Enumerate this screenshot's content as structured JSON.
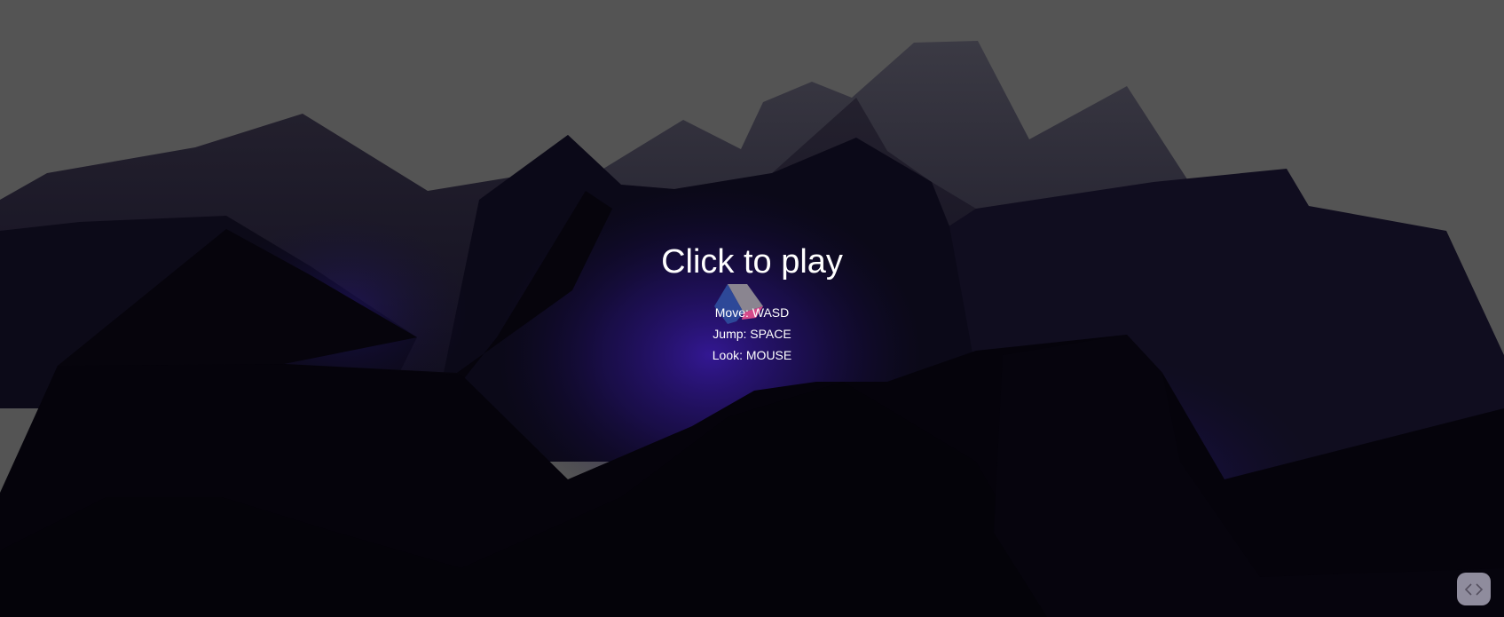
{
  "overlay": {
    "title": "Click to play",
    "controls": [
      {
        "action": "Move",
        "key": "WASD",
        "text": "Move: WASD"
      },
      {
        "action": "Jump",
        "key": "SPACE",
        "text": "Jump: SPACE"
      },
      {
        "action": "Look",
        "key": "MOUSE",
        "text": "Look: MOUSE"
      }
    ]
  },
  "scene": {
    "sky_color": "#545454",
    "terrain_dark": "#07050f",
    "terrain_mid": "#16122a",
    "glow_color": "#3a1aa8",
    "player_colors": [
      "#2f4f9e",
      "#8a8590",
      "#d54a8a"
    ]
  },
  "corner_button": {
    "icon": "code-icon"
  }
}
